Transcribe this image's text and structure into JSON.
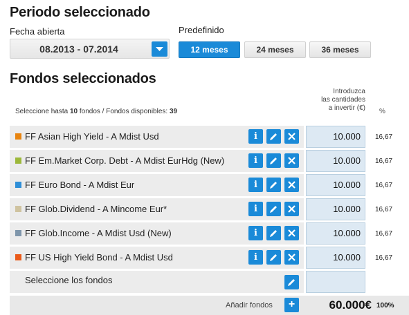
{
  "period": {
    "title": "Periodo seleccionado",
    "date_label": "Fecha abierta",
    "date_value": "08.2013 - 07.2014",
    "preset_label": "Predefinido",
    "presets": [
      "12 meses",
      "24 meses",
      "36 meses"
    ],
    "active_preset": "12 meses"
  },
  "funds": {
    "title": "Fondos seleccionados",
    "hint_prefix": "Seleccione hasta ",
    "hint_max": "10",
    "hint_middle": " fondos / Fondos disponibles: ",
    "hint_available": "39",
    "amount_header": [
      "Introduzca",
      "las cantidades",
      "a invertir (€)"
    ],
    "pct_header": "%",
    "rows": [
      {
        "name": "FF Asian High Yield - A Mdist Usd",
        "color": "#e8840f",
        "amount": "10.000",
        "pct": "16,67"
      },
      {
        "name": "FF Em.Market Corp. Debt - A Mdist EurHdg (New)",
        "color": "#9cb83a",
        "amount": "10.000",
        "pct": "16,67"
      },
      {
        "name": "FF Euro Bond - A Mdist Eur",
        "color": "#2f8fd8",
        "amount": "10.000",
        "pct": "16,67"
      },
      {
        "name": "FF Glob.Dividend - A Mincome Eur*",
        "color": "#cfc3a0",
        "amount": "10.000",
        "pct": "16,67"
      },
      {
        "name": "FF Glob.Income - A Mdist Usd (New)",
        "color": "#7f96ab",
        "amount": "10.000",
        "pct": "16,67"
      },
      {
        "name": "FF US High Yield Bond - A Mdist Usd",
        "color": "#ea5a19",
        "amount": "10.000",
        "pct": "16,67"
      }
    ],
    "select_label": "Seleccione los fondos",
    "info_glyph": "i",
    "icons": {
      "info": "info-icon",
      "edit": "pencil-icon",
      "remove": "close-icon",
      "add": "plus-icon"
    }
  },
  "footer": {
    "add_label": "Añadir fondos",
    "add_glyph": "+",
    "total": "60.000€",
    "total_pct": "100%"
  }
}
